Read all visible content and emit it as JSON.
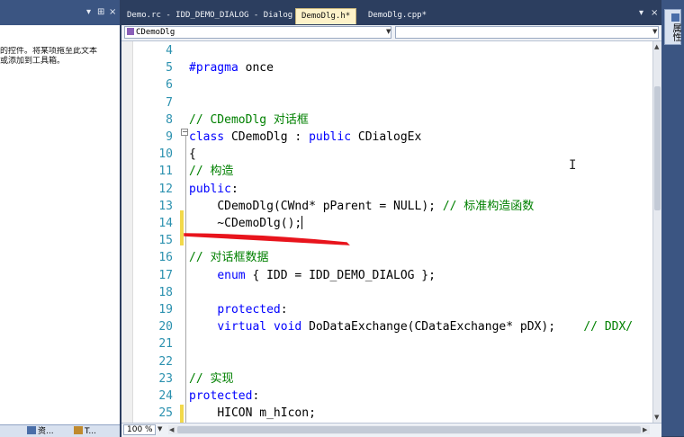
{
  "left_panel": {
    "header_controls": [
      "▾",
      "⊞",
      "×"
    ],
    "description_lines": [
      "的控件。将某项拖至此文本",
      "或添加到工具箱。"
    ],
    "bottom_tabs": [
      {
        "label": "资...",
        "icon": "resource-view-icon"
      },
      {
        "label": "T...",
        "icon": "toolbox-icon"
      }
    ]
  },
  "tabs": [
    {
      "label": "Demo.rc - IDD_DEMO_DIALOG - Dialog",
      "active": false
    },
    {
      "label": "DemoDlg.h*",
      "active": true
    },
    {
      "label": "DemoDlg.cpp*",
      "active": false
    }
  ],
  "tab_controls": [
    "▾",
    "×"
  ],
  "nav": {
    "class_combo": "CDemoDlg",
    "member_combo": ""
  },
  "code_lines": [
    {
      "num": "4",
      "text": ""
    },
    {
      "num": "5",
      "text": "#pragma once"
    },
    {
      "num": "6",
      "text": ""
    },
    {
      "num": "7",
      "text": ""
    },
    {
      "num": "8",
      "text": "// CDemoDlg 对话框"
    },
    {
      "num": "9",
      "text": "class CDemoDlg : public CDialogEx"
    },
    {
      "num": "10",
      "text": "{"
    },
    {
      "num": "11",
      "text": "// 构造"
    },
    {
      "num": "12",
      "text": "public:"
    },
    {
      "num": "13",
      "text": "    CDemoDlg(CWnd* pParent = NULL); // 标准构造函数"
    },
    {
      "num": "14",
      "text": "    ~CDemoDlg();"
    },
    {
      "num": "15",
      "text": ""
    },
    {
      "num": "16",
      "text": "// 对话框数据"
    },
    {
      "num": "17",
      "text": "    enum { IDD = IDD_DEMO_DIALOG };"
    },
    {
      "num": "18",
      "text": ""
    },
    {
      "num": "19",
      "text": "    protected:"
    },
    {
      "num": "20",
      "text": "    virtual void DoDataExchange(CDataExchange* pDX);    // DDX/"
    },
    {
      "num": "21",
      "text": ""
    },
    {
      "num": "22",
      "text": ""
    },
    {
      "num": "23",
      "text": "// 实现"
    },
    {
      "num": "24",
      "text": "protected:"
    },
    {
      "num": "25",
      "text": "    HICON m_hIcon;"
    }
  ],
  "zoom": "100 %",
  "right_strip_tab": "属性",
  "colors": {
    "keyword": "#0000ff",
    "comment": "#008000",
    "line_number": "#2b91af",
    "annotation_red": "#e8141c",
    "frame": "#2c3e5f"
  }
}
